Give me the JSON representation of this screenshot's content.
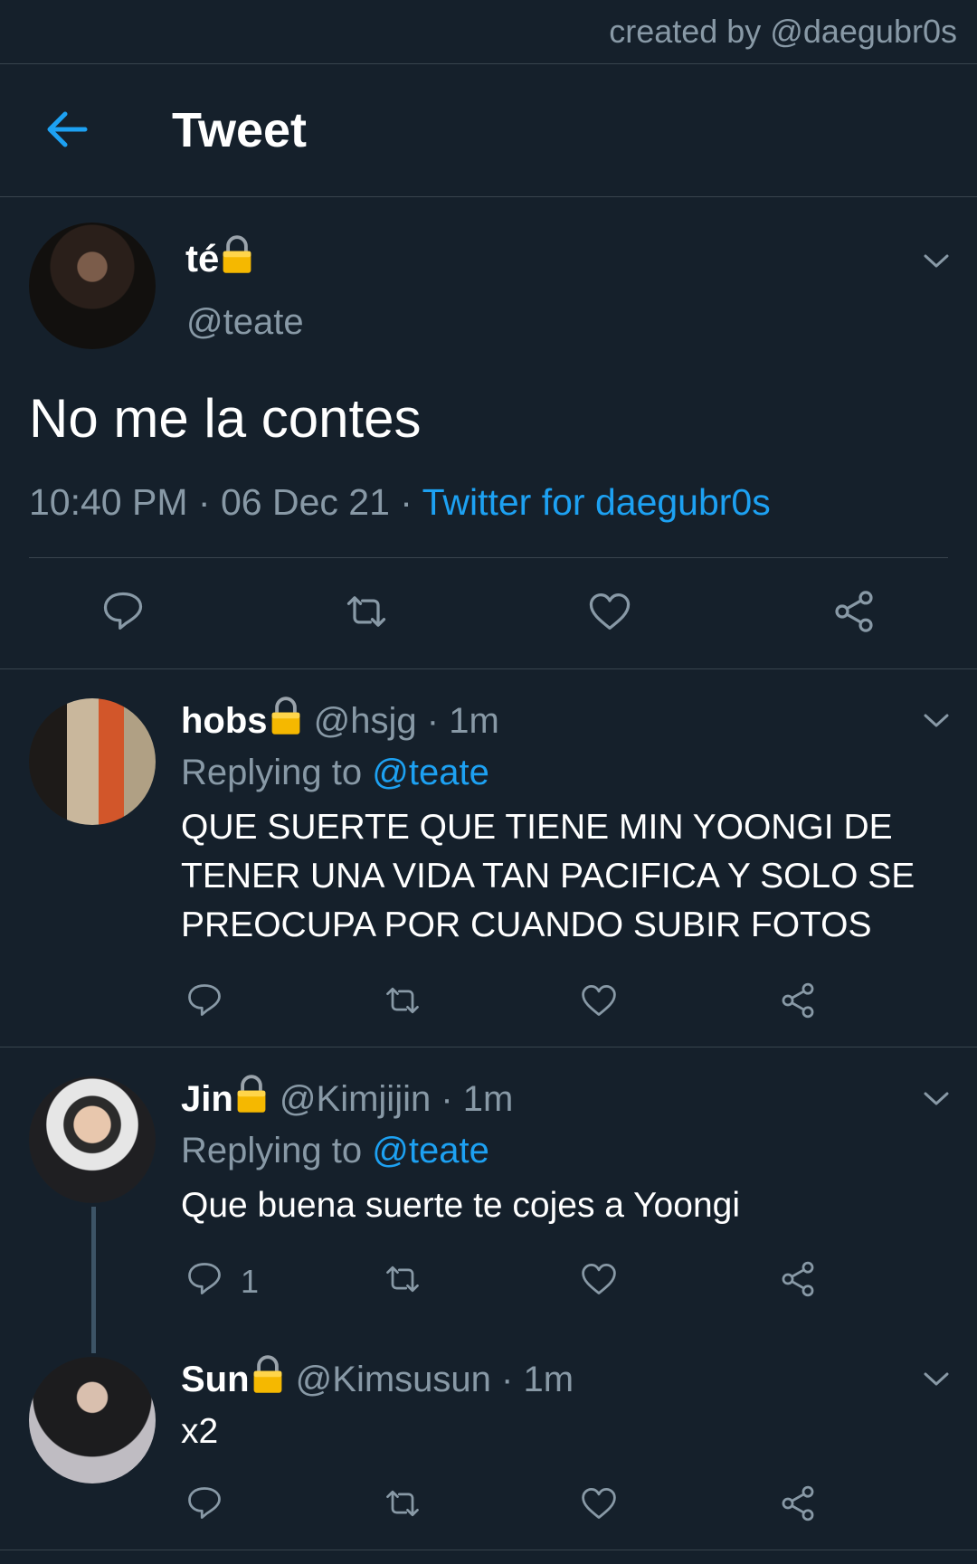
{
  "watermark": "created by @daegubr0s",
  "header": {
    "title": "Tweet"
  },
  "main_tweet": {
    "display_name": "té",
    "handle": "@teate",
    "text": "No me la contes",
    "time": "10:40 PM",
    "date": "06 Dec 21",
    "separator": "·",
    "source": "Twitter for daegubr0s"
  },
  "replies": [
    {
      "display_name": "hobs",
      "handle": "@hsjg",
      "time": "1m",
      "replying_label": "Replying to",
      "replying_handle": "@teate",
      "text": "QUE SUERTE QUE TIENE MIN YOONGI DE TENER UNA VIDA TAN PACIFICA Y SOLO SE PREOCUPA POR CUANDO SUBIR FOTOS",
      "reply_count": ""
    },
    {
      "display_name": "Jin",
      "handle": "@Kimjijin",
      "time": "1m",
      "replying_label": "Replying to",
      "replying_handle": "@teate",
      "text": "Que buena suerte te cojes a Yoongi",
      "reply_count": "1"
    },
    {
      "display_name": "Sun",
      "handle": "@Kimsusun",
      "time": "1m",
      "text": "x2",
      "reply_count": ""
    }
  ],
  "icons": [
    "back-arrow-icon",
    "lock-icon",
    "chevron-down-icon",
    "reply-icon",
    "retweet-icon",
    "like-icon",
    "share-icon"
  ],
  "colors": {
    "background": "#15202b",
    "accent": "#1da1f2",
    "muted": "#8899a6",
    "divider": "#38444d",
    "lock": "#f5c518"
  }
}
